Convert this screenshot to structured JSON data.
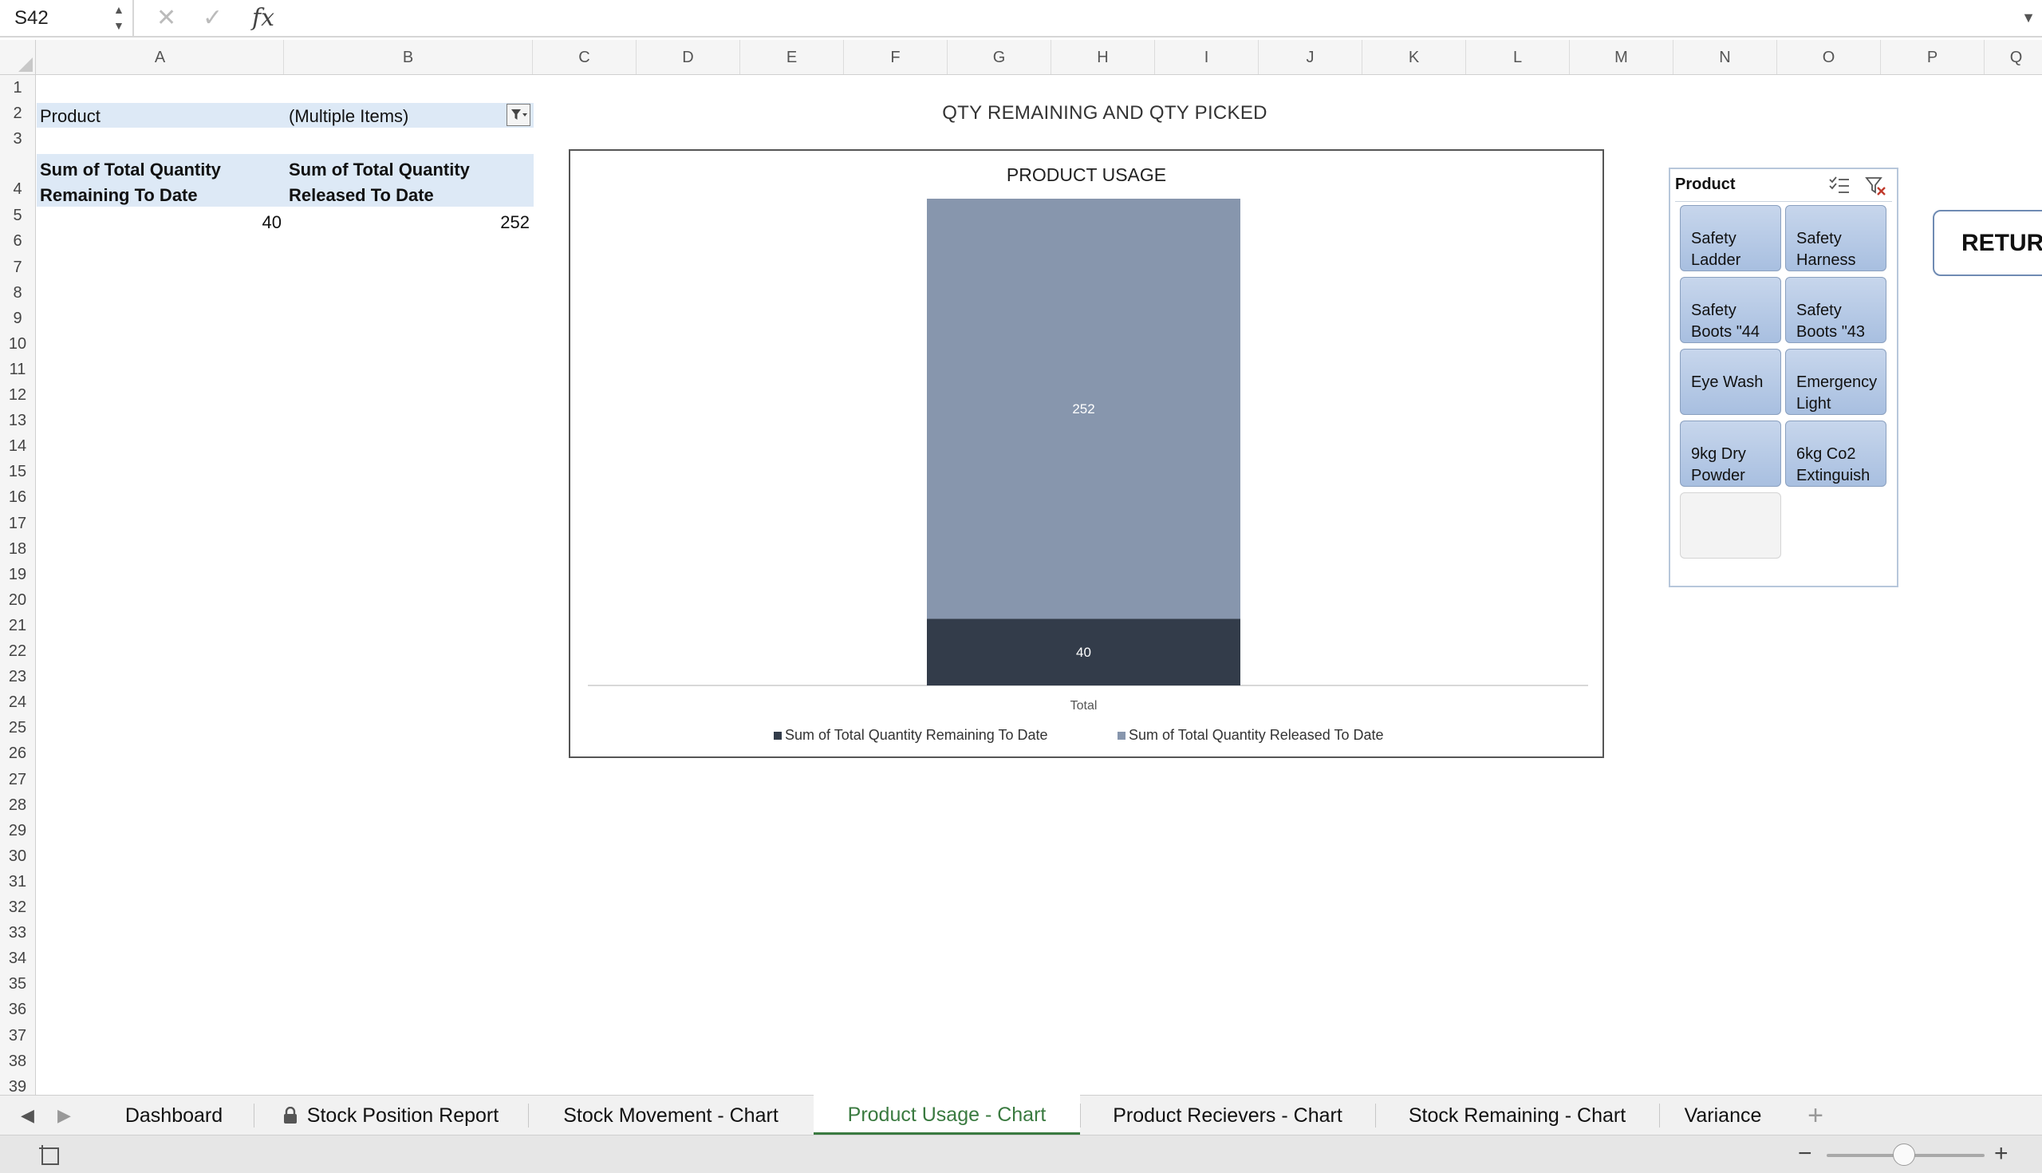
{
  "formula_bar": {
    "name_box": "S42",
    "cancel_icon": "x-icon",
    "enter_icon": "check-icon",
    "fx_label": "fx",
    "formula": ""
  },
  "columns": [
    "A",
    "B",
    "C",
    "D",
    "E",
    "F",
    "G",
    "H",
    "I",
    "J",
    "K",
    "L",
    "M",
    "N",
    "O",
    "P",
    "Q"
  ],
  "rows": [
    "1",
    "2",
    "3",
    "4",
    "5",
    "6",
    "7",
    "8",
    "9",
    "10",
    "11",
    "12",
    "13",
    "14",
    "15",
    "16",
    "17",
    "18",
    "19",
    "20",
    "21",
    "22",
    "23",
    "24",
    "25",
    "26",
    "27",
    "28",
    "29",
    "30",
    "31",
    "32",
    "33",
    "34",
    "35",
    "36",
    "37",
    "38",
    "39"
  ],
  "pivot": {
    "filter_label": "Product",
    "filter_value": "(Multiple Items)",
    "header_a_line1": "Sum of Total Quantity",
    "header_a_line2": "Remaining To Date",
    "header_b_line1": "Sum of Total Quantity",
    "header_b_line2": "Released To Date",
    "value_a": "40",
    "value_b": "252"
  },
  "sheet_title": "QTY REMAINING AND QTY PICKED",
  "chart_data": {
    "type": "bar",
    "stacked": true,
    "title": "PRODUCT USAGE",
    "categories": [
      "Total"
    ],
    "series": [
      {
        "name": "Sum of Total Quantity Remaining To Date",
        "values": [
          40
        ],
        "color": "#333c4a"
      },
      {
        "name": "Sum of Total Quantity Released To Date",
        "values": [
          252
        ],
        "color": "#8796ad"
      }
    ],
    "ylim": [
      0,
      292
    ],
    "grid": false,
    "legend": "bottom"
  },
  "slicer": {
    "title": "Product",
    "multiselect_icon": "multiselect-icon",
    "clear_filter_icon": "clear-filter-icon",
    "items": [
      {
        "line1": "Safety",
        "line2": "Ladder"
      },
      {
        "line1": "Safety",
        "line2": "Harness"
      },
      {
        "line1": "Safety",
        "line2": "Boots \"44"
      },
      {
        "line1": "Safety",
        "line2": "Boots \"43"
      },
      {
        "line1": "Eye Wash",
        "line2": ""
      },
      {
        "line1": "Emergency",
        "line2": "Light"
      },
      {
        "line1": "9kg Dry",
        "line2": "Powder"
      },
      {
        "line1": "6kg Co2",
        "line2": "Extinguish"
      },
      {
        "line1": "",
        "line2": ""
      }
    ]
  },
  "return_button": "RETURN",
  "tabs": [
    {
      "label": "Dashboard"
    },
    {
      "label": "Stock Position Report",
      "locked": true
    },
    {
      "label": "Stock Movement - Chart"
    },
    {
      "label": "Product Usage - Chart",
      "active": true
    },
    {
      "label": "Product Recievers - Chart"
    },
    {
      "label": "Stock Remaining - Chart"
    },
    {
      "label": "Variance"
    }
  ],
  "add_sheet": "+",
  "colors": {
    "accent_green": "#3a7a40",
    "pivot_fill": "#dde9f6",
    "slicer_fill": "#b4c8e6"
  }
}
